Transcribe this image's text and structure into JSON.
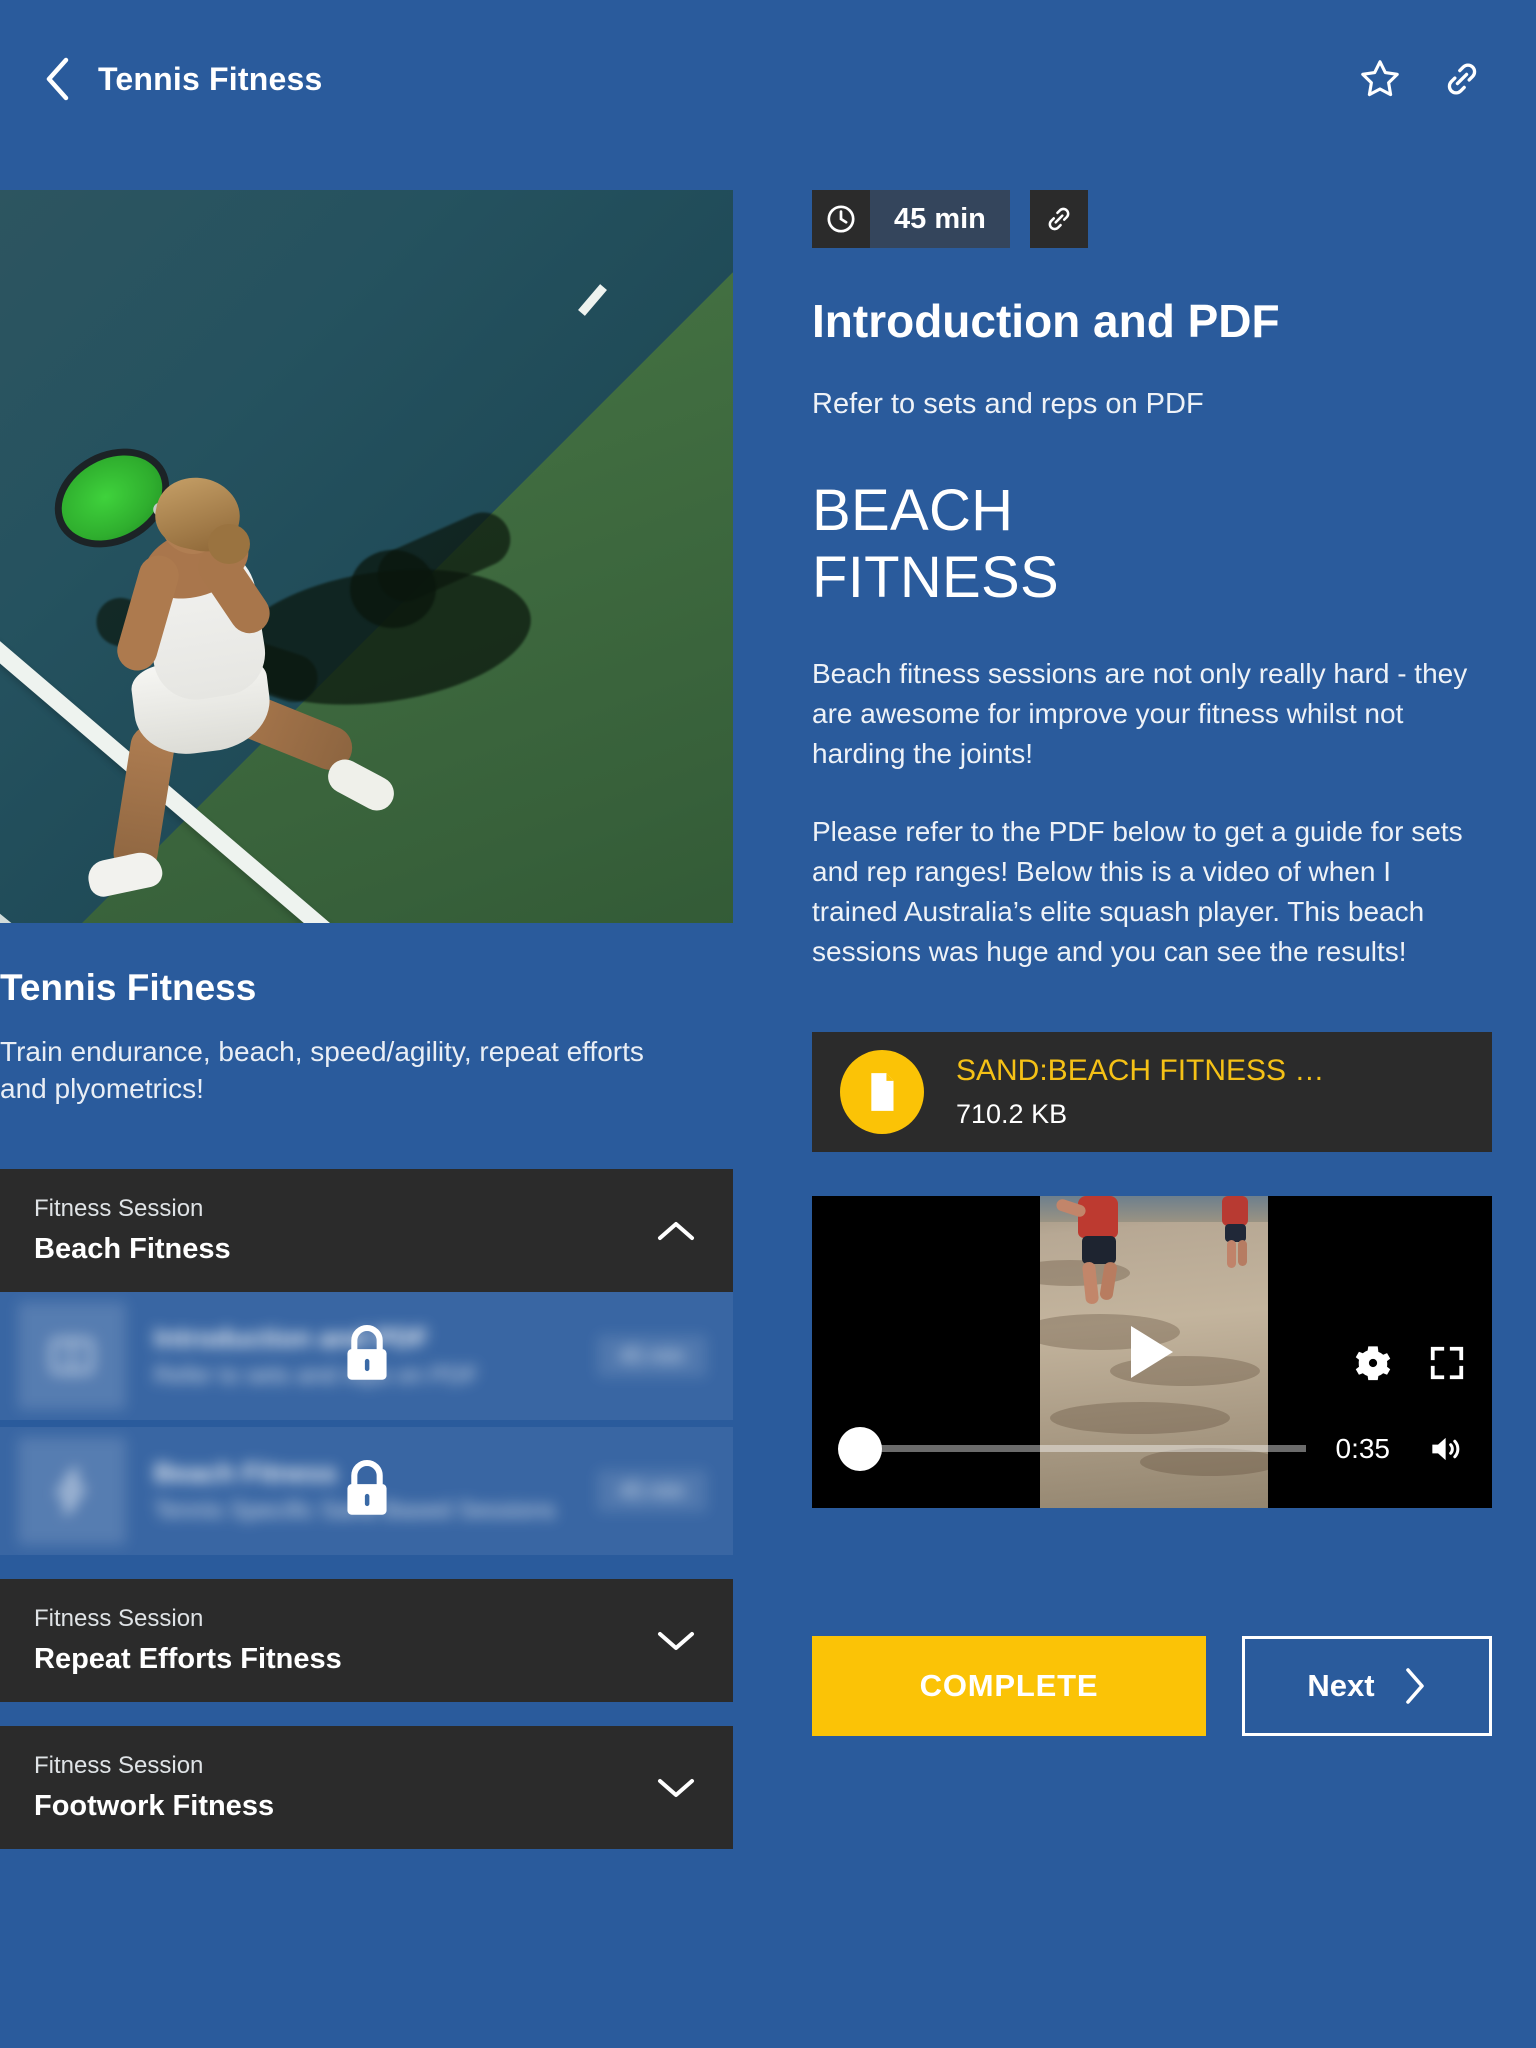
{
  "theme": {
    "page_bg": "#2A5B9C",
    "card_bg": "#2B2B2B",
    "accent_yellow": "#FBC306",
    "pdf_link_color": "#F5C116",
    "text_white": "#FFFFFF"
  },
  "topbar": {
    "back_icon": "chevron-left-icon",
    "title": "Tennis Fitness",
    "favorite_icon": "star-outline-icon",
    "share_icon": "link-icon"
  },
  "course": {
    "hero_image_alt": "tennis-court-player-photo",
    "title": "Tennis Fitness",
    "description": "Train endurance, beach, speed/agility, repeat efforts and plyometrics!"
  },
  "sessions": [
    {
      "kicker": "Fitness Session",
      "name": "Beach Fitness",
      "expanded": true,
      "chevron": "chevron-up-icon",
      "lessons": [
        {
          "icon": "book-icon",
          "title": "Introduction and PDF",
          "description": "Refer to sets and reps on PDF",
          "duration": "45 min",
          "locked": true,
          "lock_icon": "lock-icon"
        },
        {
          "icon": "lightning-bolt-icon",
          "title": "Beach Fitness",
          "description": "Tennis Specific Sand Based Sessions",
          "duration": "45 min",
          "locked": true,
          "lock_icon": "lock-icon"
        }
      ]
    },
    {
      "kicker": "Fitness Session",
      "name": "Repeat Efforts Fitness",
      "expanded": false,
      "chevron": "chevron-down-icon",
      "lessons": []
    },
    {
      "kicker": "Fitness Session",
      "name": "Footwork Fitness",
      "expanded": false,
      "chevron": "chevron-down-icon",
      "lessons": []
    }
  ],
  "lesson": {
    "duration_icon": "clock-icon",
    "duration": "45 min",
    "share_icon": "link-icon",
    "title": "Introduction and PDF",
    "subtitle": "Refer to sets and reps on PDF",
    "heading_line1": "BEACH",
    "heading_line2": "FITNESS",
    "paragraph1": "Beach fitness sessions are not only really hard - they are awesome for improve your fitness whilst not harding the joints!",
    "paragraph2": "Please refer to the PDF below to get a guide for sets and rep ranges! Below this is a video of when I trained Australia’s elite squash player. This beach sessions was huge and you can see the results!"
  },
  "attachment": {
    "icon": "document-icon",
    "name": "SAND:BEACH FITNESS …",
    "size": "710.2 KB"
  },
  "video": {
    "thumbnail_alt": "beach-sand-training-video",
    "play_icon": "play-icon",
    "settings_icon": "gear-icon",
    "fullscreen_icon": "fullscreen-icon",
    "time": "0:35",
    "volume_icon": "volume-on-icon",
    "progress_percent": 0
  },
  "footer": {
    "complete_label": "COMPLETE",
    "next_label": "Next",
    "next_icon": "chevron-right-icon"
  }
}
